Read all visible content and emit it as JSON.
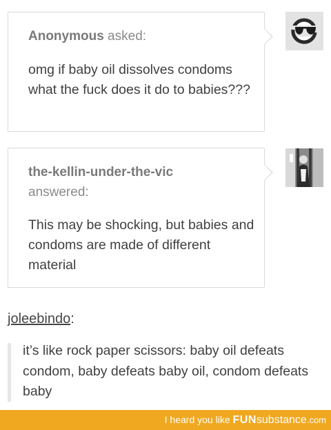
{
  "ask": {
    "asker": "Anonymous",
    "verb": " asked:",
    "question": "omg if baby oil dissolves condoms what the fuck does it do to babies???"
  },
  "answer": {
    "answerer": "the-kellin-under-the-vic",
    "verb": "answered:",
    "text": "This may be shocking, but babies and condoms are made of different material"
  },
  "reblog": {
    "user": "joleebindo",
    "suffix": ":",
    "quote": "it’s like rock paper scissors: baby oil defeats condom, baby defeats baby oil, condom defeats baby"
  },
  "footer": {
    "prefix": "I heard you like ",
    "brand_fun": "FUN",
    "brand_sub": "substance",
    "brand_com": ".com",
    "background": "#f0a820"
  },
  "icons": {
    "ask_avatar": "sunglasses-face-icon",
    "answer_avatar": "user-photo-avatar"
  }
}
